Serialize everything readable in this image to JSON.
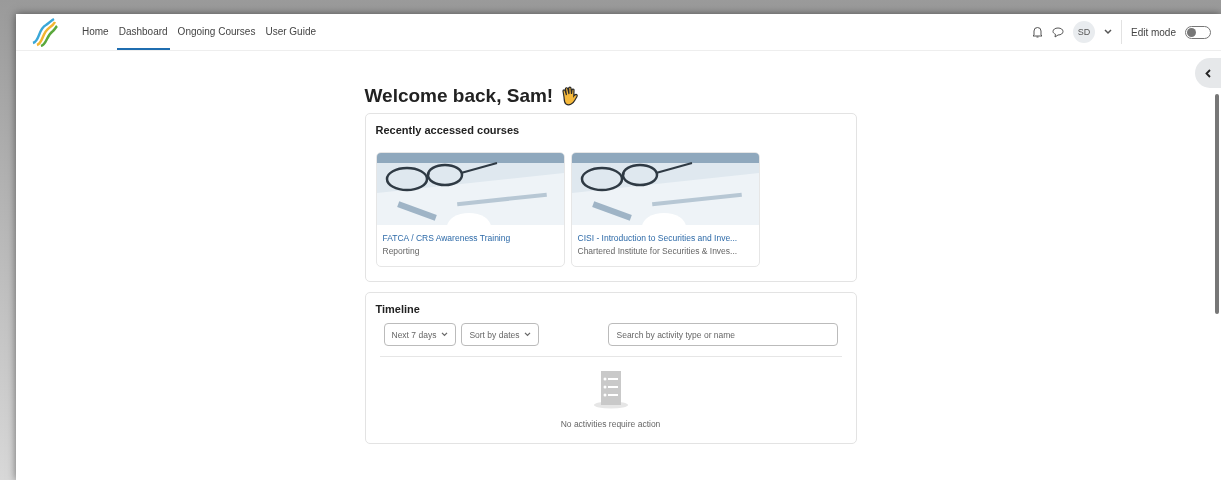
{
  "nav": {
    "items": [
      {
        "label": "Home",
        "selected": false
      },
      {
        "label": "Dashboard",
        "selected": true
      },
      {
        "label": "Ongoing Courses",
        "selected": false
      },
      {
        "label": "User Guide",
        "selected": false
      }
    ],
    "avatar": "SD",
    "edit_mode": {
      "label": "Edit mode",
      "on": false
    }
  },
  "greeting": "Welcome back, Sam!",
  "recent": {
    "title": "Recently accessed courses",
    "courses": [
      {
        "name": "FATCA / CRS Awareness Training",
        "category": "Reporting"
      },
      {
        "name": "CISI - Introduction to Securities and Inve...",
        "category": "Chartered Institute for Securities & Inves..."
      }
    ]
  },
  "timeline": {
    "title": "Timeline",
    "filters": [
      "Next 7 days",
      "Sort by dates"
    ],
    "search": {
      "placeholder": "Search by activity type or name"
    },
    "empty": "No activities require action"
  }
}
